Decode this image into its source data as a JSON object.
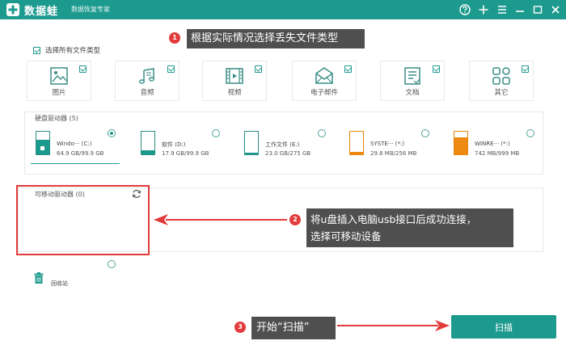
{
  "titlebar": {
    "app_name": "数据蛙",
    "app_subtitle": "数据恢复专家",
    "bg_color": "#1d9a8e"
  },
  "file_types": {
    "select_all_label": "选择所有文件类型",
    "select_all_checked": true,
    "items": [
      {
        "label": "图片",
        "icon": "image-icon",
        "checked": true
      },
      {
        "label": "音频",
        "icon": "music-icon",
        "checked": true
      },
      {
        "label": "视频",
        "icon": "video-icon",
        "checked": true
      },
      {
        "label": "电子邮件",
        "icon": "mail-icon",
        "checked": true
      },
      {
        "label": "文档",
        "icon": "document-icon",
        "checked": true
      },
      {
        "label": "其它",
        "icon": "other-icon",
        "checked": true
      }
    ]
  },
  "hard_drives": {
    "title": "硬盘驱动器 (5)",
    "items": [
      {
        "name": "Windo··· (C:)",
        "size": "64.9 GB/99.9 GB",
        "fill": 0.65,
        "color": "teal",
        "selected": true
      },
      {
        "name": "软件 (D:)",
        "size": "17.9 GB/99.9 GB",
        "fill": 0.18,
        "color": "teal",
        "selected": false
      },
      {
        "name": "工作文件 (E:)",
        "size": "23.0 GB/275 GB",
        "fill": 0.08,
        "color": "teal",
        "selected": false
      },
      {
        "name": "SYSTE··· (*:)",
        "size": "29.8 MB/256 MB",
        "fill": 0.12,
        "color": "orange",
        "selected": false
      },
      {
        "name": "WINRE··· (*:)",
        "size": "742 MB/999 MB",
        "fill": 0.74,
        "color": "orange",
        "selected": false
      }
    ]
  },
  "removable": {
    "title": "可移动驱动器 (0)"
  },
  "recycle": {
    "label": "回收站"
  },
  "annotations": {
    "a1_num": "1",
    "a1_text": "根据实际情况选择丢失文件类型",
    "a2_num": "2",
    "a2_line1": "将u盘插入电脑usb接口后成功连接，",
    "a2_line2": "选择可移动设备",
    "a3_num": "3",
    "a3_text": "开始“扫描”"
  },
  "scan_button": {
    "label": "扫描"
  },
  "colors": {
    "accent": "#1d9a8e",
    "annotation_red": "#e23b3b",
    "warning_orange": "#ee8a12"
  }
}
